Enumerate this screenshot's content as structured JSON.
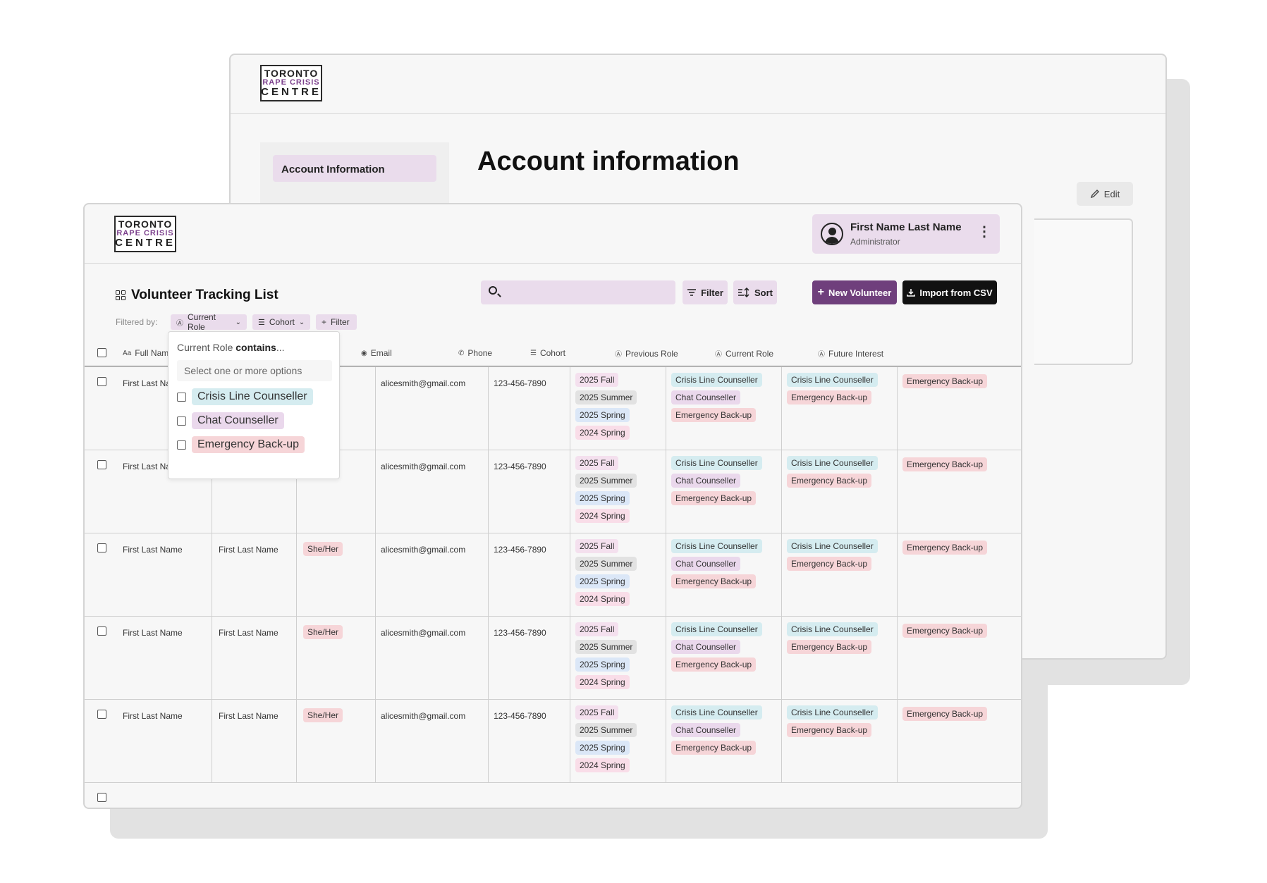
{
  "logo": {
    "line1": "TORONTO",
    "line2": "RAPE CRISIS",
    "line3": "CENTRE",
    "accent": "#7b3f8c"
  },
  "account_window": {
    "sidebar_item": "Account Information",
    "title": "Account information",
    "edit_label": "Edit"
  },
  "user": {
    "name": "First Name Last Name",
    "role": "Administrator",
    "menu_icon": "more-vertical-icon"
  },
  "list": {
    "title": "Volunteer Tracking List",
    "filter_label": "Filter",
    "sort_label": "Sort",
    "new_label": "New Volunteer",
    "import_label": "Import from CSV",
    "filtered_by": "Filtered by:",
    "chips": [
      "Current Role",
      "Cohort",
      "Filter"
    ],
    "brand_color": "#6f3f7c"
  },
  "dropdown": {
    "head_prefix": "Current Role",
    "head_bold": "contains",
    "head_suffix": "...",
    "placeholder": "Select one or more options",
    "options": [
      "Crisis Line Counseller",
      "Chat Counseller",
      "Emergency Back-up"
    ]
  },
  "columns": {
    "full_name": "Full Nam",
    "pronouns": "ns",
    "email": "Email",
    "phone": "Phone",
    "cohort": "Cohort",
    "previous_role": "Previous Role",
    "current_role": "Current Role",
    "future_interest": "Future Interest"
  },
  "rows": [
    {
      "full_name": "First Last Na",
      "preferred_name": "",
      "pronouns": "",
      "email": "alicesmith@gmail.com",
      "phone": "123-456-7890",
      "cohort": [
        "2025 Fall",
        "2025 Summer",
        "2025 Spring",
        "2024 Spring"
      ],
      "previous_role": [
        "Crisis Line Counseller",
        "Chat Counseller",
        "Emergency Back-up"
      ],
      "current_role": [
        "Crisis Line Counseller",
        "Emergency Back-up"
      ],
      "future_interest": [
        "Emergency Back-up"
      ]
    },
    {
      "full_name": "First Last Na",
      "preferred_name": "",
      "pronouns": "",
      "email": "alicesmith@gmail.com",
      "phone": "123-456-7890",
      "cohort": [
        "2025 Fall",
        "2025 Summer",
        "2025 Spring",
        "2024 Spring"
      ],
      "previous_role": [
        "Crisis Line Counseller",
        "Chat Counseller",
        "Emergency Back-up"
      ],
      "current_role": [
        "Crisis Line Counseller",
        "Emergency Back-up"
      ],
      "future_interest": [
        "Emergency Back-up"
      ]
    },
    {
      "full_name": "First Last Name",
      "preferred_name": "First Last Name",
      "pronouns": "She/Her",
      "email": "alicesmith@gmail.com",
      "phone": "123-456-7890",
      "cohort": [
        "2025 Fall",
        "2025 Summer",
        "2025 Spring",
        "2024 Spring"
      ],
      "previous_role": [
        "Crisis Line Counseller",
        "Chat Counseller",
        "Emergency Back-up"
      ],
      "current_role": [
        "Crisis Line Counseller",
        "Emergency Back-up"
      ],
      "future_interest": [
        "Emergency Back-up"
      ]
    },
    {
      "full_name": "First Last Name",
      "preferred_name": "First Last Name",
      "pronouns": "She/Her",
      "email": "alicesmith@gmail.com",
      "phone": "123-456-7890",
      "cohort": [
        "2025 Fall",
        "2025 Summer",
        "2025 Spring",
        "2024 Spring"
      ],
      "previous_role": [
        "Crisis Line Counseller",
        "Chat Counseller",
        "Emergency Back-up"
      ],
      "current_role": [
        "Crisis Line Counseller",
        "Emergency Back-up"
      ],
      "future_interest": [
        "Emergency Back-up"
      ]
    },
    {
      "full_name": "First Last Name",
      "preferred_name": "First Last Name",
      "pronouns": "She/Her",
      "email": "alicesmith@gmail.com",
      "phone": "123-456-7890",
      "cohort": [
        "2025 Fall",
        "2025 Summer",
        "2025 Spring",
        "2024 Spring"
      ],
      "previous_role": [
        "Crisis Line Counseller",
        "Chat Counseller",
        "Emergency Back-up"
      ],
      "current_role": [
        "Crisis Line Counseller",
        "Emergency Back-up"
      ],
      "future_interest": [
        "Emergency Back-up"
      ]
    }
  ]
}
